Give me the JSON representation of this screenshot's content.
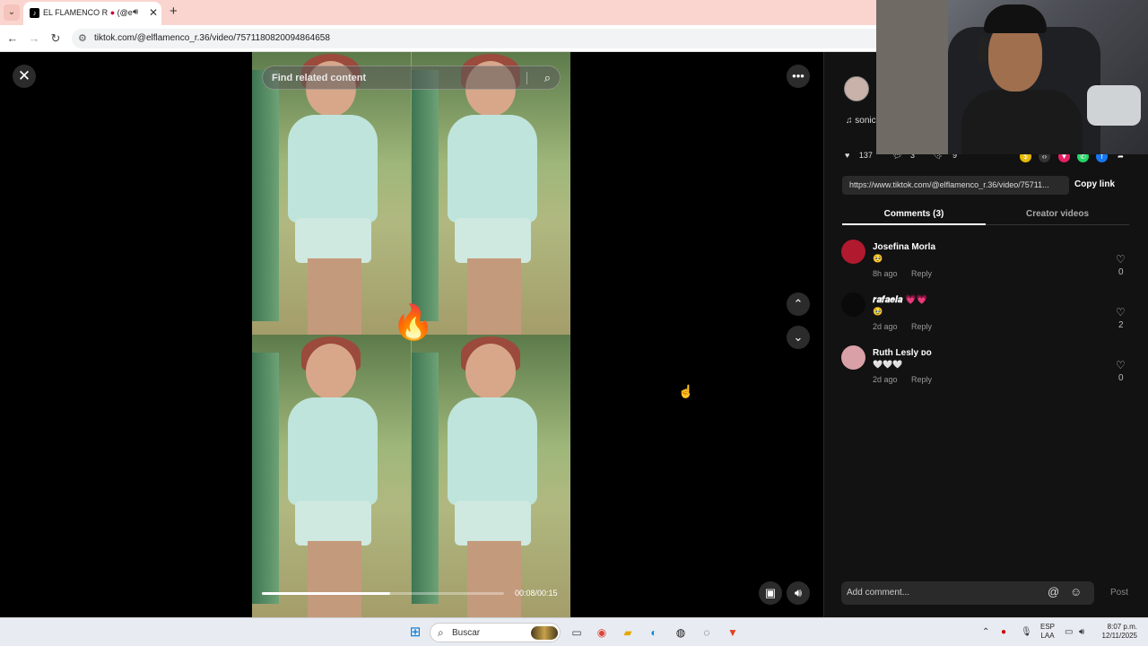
{
  "browser": {
    "tab_title": "EL FLAMENCO R",
    "tab_title_handle": "(@elfl",
    "url": "tiktok.com/@elflamenco_r.36/video/7571180820094864658"
  },
  "video": {
    "search_placeholder": "Find related content",
    "timecode": "00:08/00:15",
    "progress": 0.53
  },
  "panel": {
    "music_label": "sonic",
    "likes": "137",
    "comments_count": "3",
    "saves": "9",
    "share_url": "https://www.tiktok.com/@elflamenco_r.36/video/75711...",
    "copy_link": "Copy link",
    "tabs": [
      "Comments (3)",
      "Creator videos"
    ],
    "comments": [
      {
        "name": "Josefina Morla",
        "text": "🥺",
        "time": "8h ago",
        "reply": "Reply",
        "likes": "0",
        "avatar_color": "#b11a2e"
      },
      {
        "name": "𝒓𝒂𝒇𝒂𝒆𝒍𝒂 💗💗",
        "text": "🥹",
        "time": "2d ago",
        "reply": "Reply",
        "likes": "2",
        "avatar_color": "#0a0a0a"
      },
      {
        "name": "Ruth Lesly ᴅᴏ",
        "text": "🤍🤍🤍",
        "time": "2d ago",
        "reply": "Reply",
        "likes": "0",
        "avatar_color": "#d9a0a8"
      }
    ],
    "add_comment_placeholder": "Add comment...",
    "post_label": "Post"
  },
  "taskbar": {
    "search_label": "Buscar",
    "lang_top": "ESP",
    "lang_bottom": "LAA",
    "time": "8:07 p.m.",
    "date": "12/11/2025"
  },
  "colors": {
    "tab_bar": "#fad5cf",
    "panel_bg": "#121212",
    "taskbar_bg": "#e8ecf2"
  }
}
